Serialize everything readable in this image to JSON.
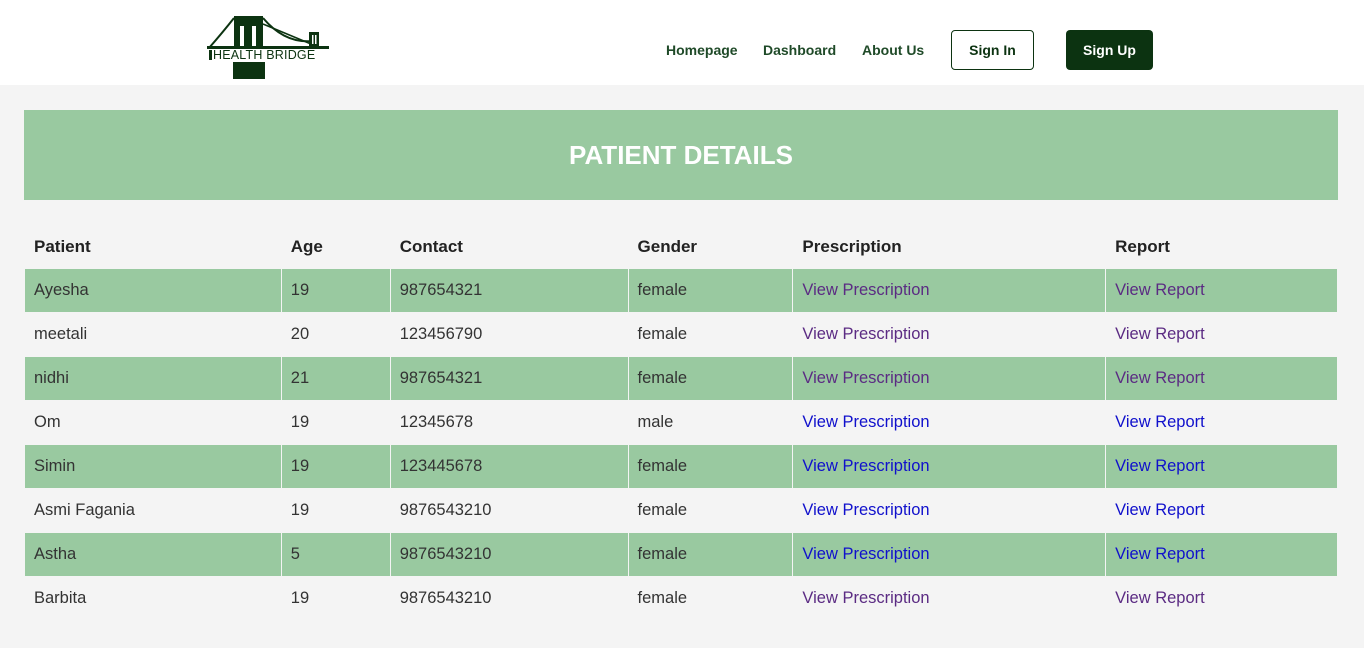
{
  "brand": {
    "logo_text": "HEALTH BRIDGE",
    "color": "#0c3311"
  },
  "nav": {
    "homepage": "Homepage",
    "dashboard": "Dashboard",
    "about": "About Us",
    "signin": "Sign In",
    "signup": "Sign Up"
  },
  "page": {
    "title": "PATIENT DETAILS",
    "accent": "#99c9a0"
  },
  "table": {
    "headers": [
      "Patient",
      "Age",
      "Contact",
      "Gender",
      "Prescription",
      "Report"
    ],
    "link_colors": {
      "visited": "#5b2b83",
      "unvisited": "#1010cc"
    },
    "rows": [
      {
        "patient": "Ayesha",
        "age": "19",
        "contact": "987654321",
        "gender": "female",
        "prescription": "View Prescription",
        "report": "View Report",
        "visited": true
      },
      {
        "patient": "meetali",
        "age": "20",
        "contact": "123456790",
        "gender": "female",
        "prescription": "View Prescription",
        "report": "View Report",
        "visited": true
      },
      {
        "patient": "nidhi",
        "age": "21",
        "contact": "987654321",
        "gender": "female",
        "prescription": "View Prescription",
        "report": "View Report",
        "visited": true
      },
      {
        "patient": "Om",
        "age": "19",
        "contact": "12345678",
        "gender": "male",
        "prescription": "View Prescription",
        "report": "View Report",
        "visited": false
      },
      {
        "patient": "Simin",
        "age": "19",
        "contact": "123445678",
        "gender": "female",
        "prescription": "View Prescription",
        "report": "View Report",
        "visited": false
      },
      {
        "patient": "Asmi Fagania",
        "age": "19",
        "contact": "9876543210",
        "gender": "female",
        "prescription": "View Prescription",
        "report": "View Report",
        "visited": false
      },
      {
        "patient": "Astha",
        "age": "5",
        "contact": "9876543210",
        "gender": "female",
        "prescription": "View Prescription",
        "report": "View Report",
        "visited": false
      },
      {
        "patient": "Barbita",
        "age": "19",
        "contact": "9876543210",
        "gender": "female",
        "prescription": "View Prescription",
        "report": "View Report",
        "visited": true
      }
    ]
  }
}
